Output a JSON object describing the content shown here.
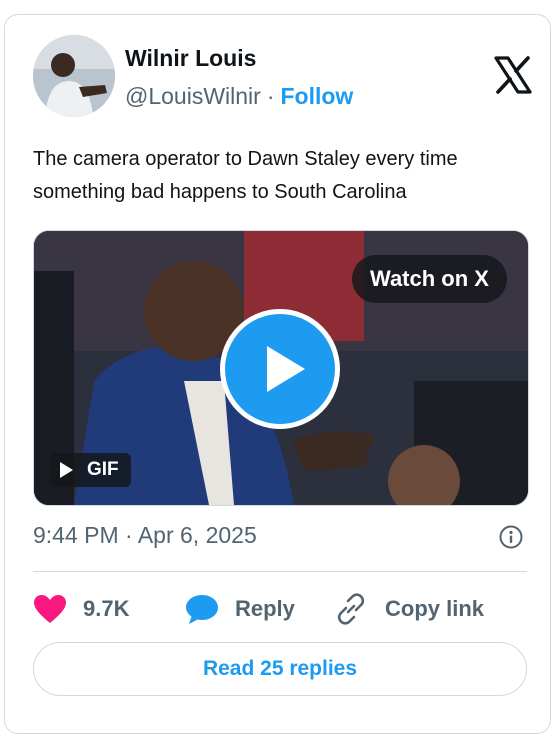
{
  "author": {
    "name": "Wilnir Louis",
    "handle": "@LouisWilnir",
    "separator": "·",
    "follow_label": "Follow"
  },
  "post": {
    "text": "The camera operator to Dawn Staley every time something bad happens to South Carolina",
    "timestamp": "9:44 PM · Apr 6, 2025"
  },
  "media": {
    "watch_label": "Watch on X",
    "gif_label": "GIF"
  },
  "actions": {
    "like_count": "9.7K",
    "reply_label": "Reply",
    "copy_link_label": "Copy link"
  },
  "read_replies_label": "Read 25 replies",
  "colors": {
    "accent": "#1d9bf0",
    "like": "#f91880",
    "muted": "#536471",
    "border": "#cfd9de"
  },
  "icons": [
    "x-logo-icon",
    "info-icon",
    "heart-icon",
    "reply-bubble-icon",
    "link-icon",
    "play-icon"
  ]
}
